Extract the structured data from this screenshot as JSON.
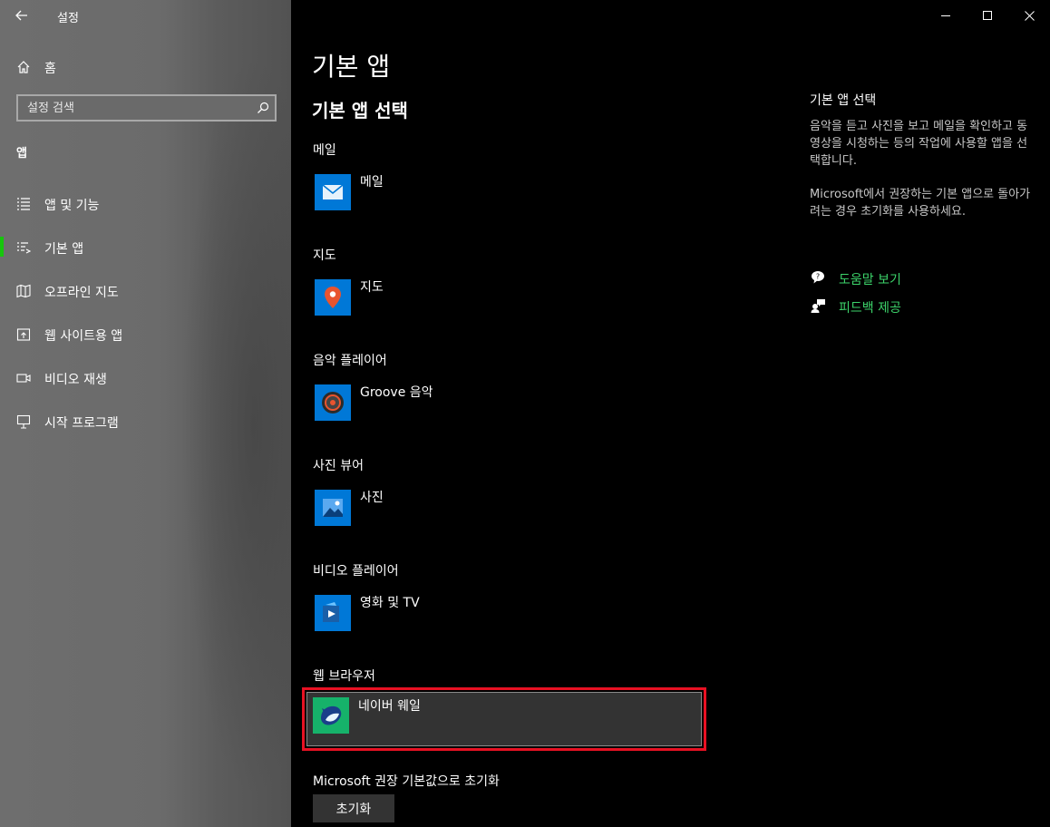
{
  "window": {
    "title": "설정"
  },
  "sidebar": {
    "home_label": "홈",
    "search_placeholder": "설정 검색",
    "section_title": "앱",
    "items": [
      {
        "label": "앱 및 기능",
        "icon": "apps-features-icon",
        "selected": false
      },
      {
        "label": "기본 앱",
        "icon": "default-apps-icon",
        "selected": true
      },
      {
        "label": "오프라인 지도",
        "icon": "offline-maps-icon",
        "selected": false
      },
      {
        "label": "웹 사이트용 앱",
        "icon": "apps-for-websites-icon",
        "selected": false
      },
      {
        "label": "비디오 재생",
        "icon": "video-playback-icon",
        "selected": false
      },
      {
        "label": "시작 프로그램",
        "icon": "startup-icon",
        "selected": false
      }
    ],
    "accent_color": "#16c60c"
  },
  "main": {
    "page_title": "기본 앱",
    "subtitle": "기본 앱 선택",
    "categories": [
      {
        "label": "메일",
        "app": "메일",
        "icon": "mail-icon"
      },
      {
        "label": "지도",
        "app": "지도",
        "icon": "maps-icon"
      },
      {
        "label": "음악 플레이어",
        "app": "Groove 음악",
        "icon": "groove-music-icon"
      },
      {
        "label": "사진 뷰어",
        "app": "사진",
        "icon": "photos-icon"
      },
      {
        "label": "비디오 플레이어",
        "app": "영화 및 TV",
        "icon": "movies-tv-icon"
      },
      {
        "label": "웹 브라우저",
        "app": "네이버 웨일",
        "icon": "naver-whale-icon"
      }
    ],
    "reset_label": "Microsoft 권장 기본값으로 초기화",
    "reset_button": "초기화"
  },
  "right_panel": {
    "title": "기본 앱 선택",
    "description": "음악을 듣고 사진을 보고 메일을 확인하고 동영상을 시청하는 등의 작업에 사용할 앱을 선택합니다.",
    "description2": "Microsoft에서 권장하는 기본 앱으로 돌아가려는 경우 초기화를 사용하세요.",
    "links": [
      {
        "label": "도움말 보기",
        "icon": "help-icon"
      },
      {
        "label": "피드백 제공",
        "icon": "feedback-icon"
      }
    ],
    "link_color": "#3cd36a"
  },
  "highlight_color": "#e81123"
}
